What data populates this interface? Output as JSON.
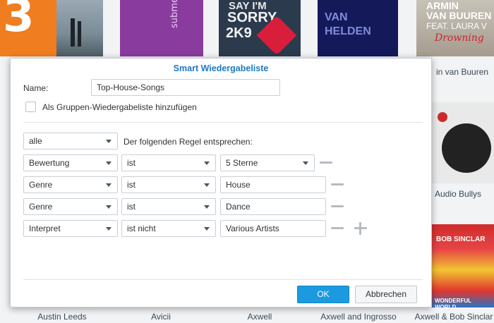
{
  "dialog": {
    "title": "Smart Wiedergabeliste",
    "name_label": "Name:",
    "name_value": "Top-House-Songs",
    "group_checkbox_label": "Als Gruppen-Wiedergabeliste hinzufügen",
    "group_checked": false,
    "match_select": "alle",
    "match_text": "Der folgenden Regel entsprechen:",
    "rules": [
      {
        "field": "Bewertung",
        "operator": "ist",
        "value": "5 Sterne",
        "value_is_select": true
      },
      {
        "field": "Genre",
        "operator": "ist",
        "value": "House",
        "value_is_select": false
      },
      {
        "field": "Genre",
        "operator": "ist",
        "value": "Dance",
        "value_is_select": false
      },
      {
        "field": "Interpret",
        "operator": "ist nicht",
        "value": "Various Artists",
        "value_is_select": false
      }
    ],
    "ok_label": "OK",
    "cancel_label": "Abbrechen"
  },
  "background": {
    "album_art_texts": {
      "tile_digit": "3",
      "sorry_line1": "SAY I'M",
      "sorry_line2": "SORRY",
      "sorry_line3": "2K9",
      "submental": "submental",
      "armin_line1": "ARMIN",
      "armin_line2": "VAN BUUREN",
      "armin_line3": "FEAT. LAURA V",
      "armin_line4": "Drowning",
      "helden_line1": "VAN",
      "helden_line2": "HELDEN",
      "bob_line1": "BOB SINCLAR",
      "bob_line2": "WONDERFUL WORLD"
    },
    "right_labels": {
      "armin": "in van Buuren",
      "audio_bullys": "Audio Bullys"
    },
    "captions": [
      "Austin Leeds",
      "Avicii",
      "Axwell",
      "Axwell and Ingrosso",
      "Axwell & Bob Sinclar"
    ]
  },
  "colors": {
    "accent": "#1c79c8",
    "primary_button": "#1b9ae0",
    "orange_tile": "#f07d1f"
  }
}
